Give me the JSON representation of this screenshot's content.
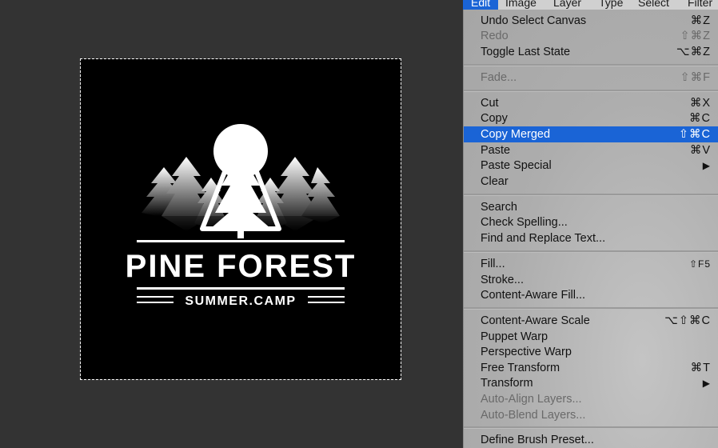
{
  "menubar": {
    "items": [
      {
        "label": "Edit",
        "active": true
      },
      {
        "label": "Image"
      },
      {
        "label": "Layer"
      },
      {
        "label": "Type"
      },
      {
        "label": "Select"
      },
      {
        "label": "Filter"
      }
    ]
  },
  "edit_menu": {
    "items": [
      {
        "label": "Undo Select Canvas",
        "shortcut": "⌘Z"
      },
      {
        "label": "Redo",
        "shortcut": "⇧⌘Z",
        "disabled": true
      },
      {
        "label": "Toggle Last State",
        "shortcut": "⌥⌘Z"
      },
      {
        "label": "Fade...",
        "shortcut": "⇧⌘F",
        "disabled": true
      },
      {
        "label": "Cut",
        "shortcut": "⌘X"
      },
      {
        "label": "Copy",
        "shortcut": "⌘C"
      },
      {
        "label": "Copy Merged",
        "shortcut": "⇧⌘C",
        "highlighted": true
      },
      {
        "label": "Paste",
        "shortcut": "⌘V"
      },
      {
        "label": "Paste Special",
        "shortcut": "▶"
      },
      {
        "label": "Clear",
        "shortcut": ""
      },
      {
        "label": "Search",
        "shortcut": ""
      },
      {
        "label": "Check Spelling...",
        "shortcut": ""
      },
      {
        "label": "Find and Replace Text...",
        "shortcut": ""
      },
      {
        "label": "Fill...",
        "shortcut": "⇧F5"
      },
      {
        "label": "Stroke...",
        "shortcut": ""
      },
      {
        "label": "Content-Aware Fill...",
        "shortcut": ""
      },
      {
        "label": "Content-Aware Scale",
        "shortcut": "⌥⇧⌘C"
      },
      {
        "label": "Puppet Warp",
        "shortcut": ""
      },
      {
        "label": "Perspective Warp",
        "shortcut": ""
      },
      {
        "label": "Free Transform",
        "shortcut": "⌘T"
      },
      {
        "label": "Transform",
        "shortcut": "▶"
      },
      {
        "label": "Auto-Align Layers...",
        "shortcut": "",
        "disabled": true
      },
      {
        "label": "Auto-Blend Layers...",
        "shortcut": "",
        "disabled": true
      },
      {
        "label": "Define Brush Preset...",
        "shortcut": ""
      }
    ]
  },
  "artwork": {
    "title": "PINE FOREST",
    "subtitle": "SUMMER.CAMP",
    "background_color": "#000000",
    "foreground_color": "#ffffff"
  },
  "colors": {
    "highlight": "#1a64d6",
    "canvas_background": "#333333",
    "menu_background": "#adadad"
  }
}
